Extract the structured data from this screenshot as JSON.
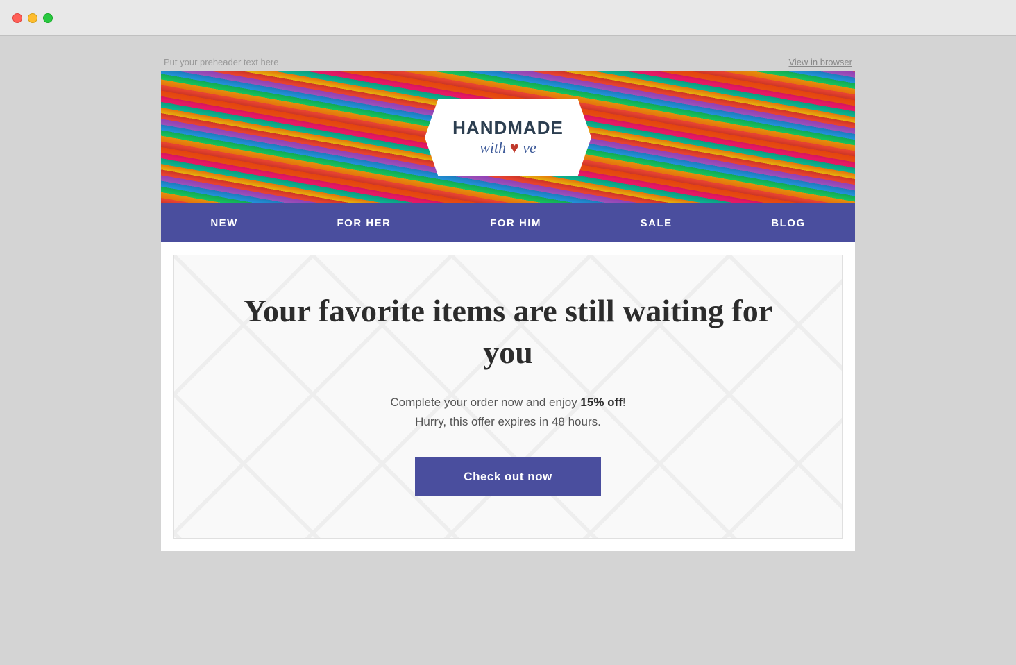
{
  "window": {
    "traffic_lights": [
      "red",
      "yellow",
      "green"
    ]
  },
  "preheader": {
    "text": "Put your preheader text here",
    "view_in_browser": "View in browser"
  },
  "header": {
    "logo_title": "HANDMADE",
    "logo_subtitle": "with",
    "logo_heart": "♥",
    "logo_word": "ve"
  },
  "nav": {
    "items": [
      {
        "label": "NEW"
      },
      {
        "label": "FOR HER"
      },
      {
        "label": "FOR HIM"
      },
      {
        "label": "SALE"
      },
      {
        "label": "BLOG"
      }
    ]
  },
  "main": {
    "heading": "Your favorite items are still waiting for you",
    "subtext_part1": "Complete your order now and enjoy ",
    "subtext_bold": "15% off",
    "subtext_part2": "!",
    "subtext_line2": "Hurry, this offer expires in 48 hours.",
    "cta_label": "Check out now"
  }
}
